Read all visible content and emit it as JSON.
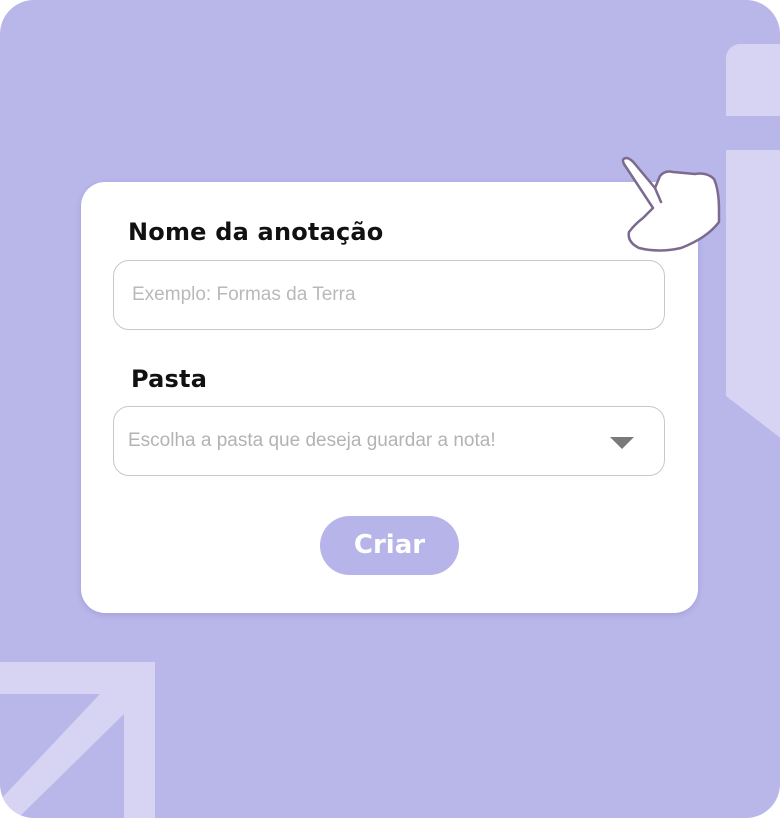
{
  "form": {
    "name_label": "Nome da anotação",
    "name_placeholder": "Exemplo: Formas da Terra",
    "name_value": "",
    "folder_label": "Pasta",
    "folder_placeholder": "Escolha a pasta que deseja guardar a nota!",
    "create_label": "Criar"
  },
  "icons": {
    "hand": "pointing-hand-icon",
    "dropdown": "chevron-down-icon",
    "decoration": "arrow-up-right-icon"
  },
  "colors": {
    "background": "#b9b7e9",
    "accent": "#b7b4ea",
    "decoration": "#d6d3f3"
  }
}
